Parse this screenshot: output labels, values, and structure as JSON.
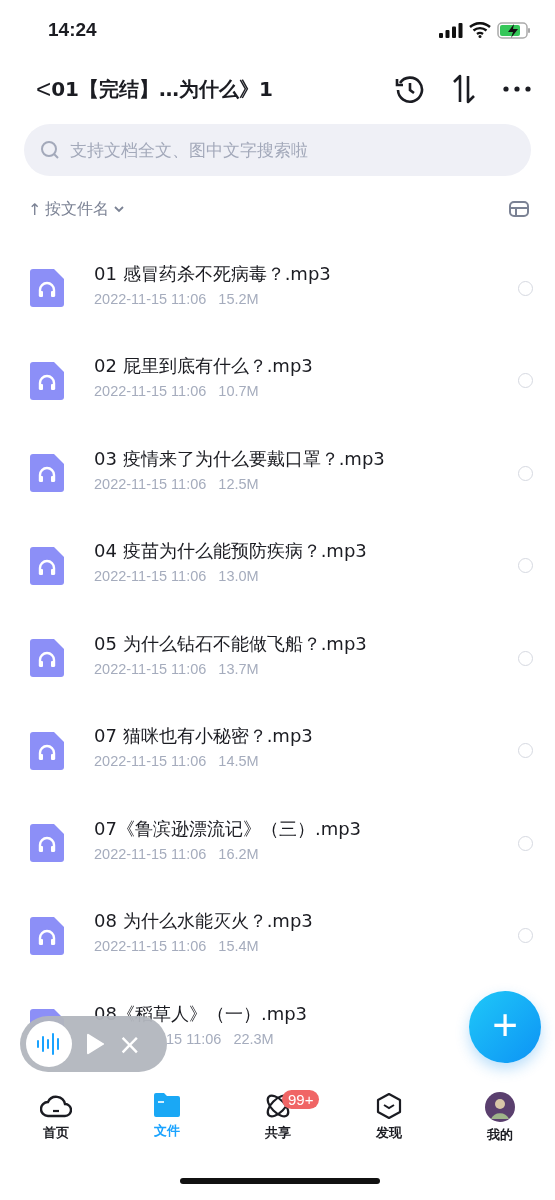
{
  "status_bar": {
    "time": "14:24"
  },
  "header": {
    "back": "<",
    "title": "01【完结】…为什么》1"
  },
  "search": {
    "placeholder": "支持文档全文、图中文字搜索啦"
  },
  "sort": {
    "arrow": "↑",
    "label": "按文件名"
  },
  "files": [
    {
      "name": "01 感冒药杀不死病毒？.mp3",
      "date": "2022-11-15 11:06",
      "size": "15.2M",
      "selected": false
    },
    {
      "name": "02 屁里到底有什么？.mp3",
      "date": "2022-11-15 11:06",
      "size": "10.7M",
      "selected": false
    },
    {
      "name": "03 疫情来了为什么要戴口罩？.mp3",
      "date": "2022-11-15 11:06",
      "size": "12.5M",
      "selected": false
    },
    {
      "name": "04 疫苗为什么能预防疾病？.mp3",
      "date": "2022-11-15 11:06",
      "size": "13.0M",
      "selected": false
    },
    {
      "name": "05 为什么钻石不能做飞船？.mp3",
      "date": "2022-11-15 11:06",
      "size": "13.7M",
      "selected": false
    },
    {
      "name": "07 猫咪也有小秘密？.mp3",
      "date": "2022-11-15 11:06",
      "size": "14.5M",
      "selected": false
    },
    {
      "name": "07《鲁滨逊漂流记》（三）.mp3",
      "date": "2022-11-15 11:06",
      "size": "16.2M",
      "selected": false
    },
    {
      "name": "08 为什么水能灭火？.mp3",
      "date": "2022-11-15 11:06",
      "size": "15.4M",
      "selected": false
    },
    {
      "name": "08《稻草人》（一）.mp3",
      "date": "15 11:06",
      "size": "22.3M",
      "covered": true
    }
  ],
  "player": {
    "close": "×"
  },
  "fab": {
    "label": "+"
  },
  "tabs": [
    {
      "kind": "home",
      "label": "首页",
      "selected": false
    },
    {
      "kind": "files",
      "label": "文件",
      "selected": true
    },
    {
      "kind": "share",
      "label": "共享",
      "selected": false,
      "badge": "99+"
    },
    {
      "kind": "discover",
      "label": "发现",
      "selected": false
    },
    {
      "kind": "avatar",
      "label": "我的",
      "selected": false
    }
  ]
}
